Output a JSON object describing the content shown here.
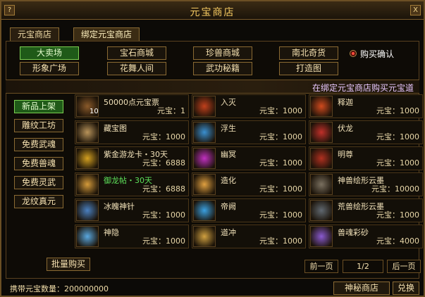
{
  "window": {
    "title": "元宝商店",
    "help_icon": "?",
    "close_icon": "X"
  },
  "tabs": [
    {
      "label": "元宝商店",
      "active": false
    },
    {
      "label": "绑定元宝商店",
      "active": true
    }
  ],
  "categories": [
    {
      "label": "大卖场",
      "active": true
    },
    {
      "label": "宝石商城",
      "active": false
    },
    {
      "label": "珍兽商城",
      "active": false
    },
    {
      "label": "南北奇货",
      "active": false
    },
    {
      "label": "形象广场",
      "active": false
    },
    {
      "label": "花舞人间",
      "active": false
    },
    {
      "label": "武功秘籍",
      "active": false
    },
    {
      "label": "打造图",
      "active": false
    }
  ],
  "purchase_confirm": {
    "label": "购买确认",
    "checked": true
  },
  "banner": "在绑定元宝商店购买元宝道",
  "side_menu": [
    {
      "label": "新品上架",
      "active": true
    },
    {
      "label": "雕纹工坊",
      "active": false
    },
    {
      "label": "免费武魂",
      "active": false
    },
    {
      "label": "免费兽魂",
      "active": false
    },
    {
      "label": "免费灵武",
      "active": false
    },
    {
      "label": "龙纹真元",
      "active": false
    }
  ],
  "items": [
    {
      "name": "50000点元宝票",
      "price": "元宝：1",
      "qty": "10",
      "icon": "ticket-icon",
      "color": "#8a5a2a",
      "green": false
    },
    {
      "name": "入灭",
      "price": "元宝：1000",
      "qty": "",
      "icon": "fire-skill-icon",
      "color": "#c0401c",
      "green": false
    },
    {
      "name": "释迦",
      "price": "元宝：1000",
      "qty": "",
      "icon": "flame-skill-icon",
      "color": "#d04a1e",
      "green": false
    },
    {
      "name": "藏宝图",
      "price": "元宝：1000",
      "qty": "",
      "icon": "treasure-map-icon",
      "color": "#b8935a",
      "green": false
    },
    {
      "name": "浮生",
      "price": "元宝：1000",
      "qty": "",
      "icon": "ice-skill-icon",
      "color": "#3a8fd0",
      "green": false
    },
    {
      "name": "伏龙",
      "price": "元宝：1000",
      "qty": "",
      "icon": "blade-icon",
      "color": "#c0302a",
      "green": false
    },
    {
      "name": "紫金游龙卡・30天",
      "price": "元宝：6888",
      "qty": "",
      "icon": "dragon-card-icon",
      "color": "#d4a020",
      "green": false
    },
    {
      "name": "幽冥",
      "price": "元宝：1000",
      "qty": "",
      "icon": "void-skill-icon",
      "color": "#c030c0",
      "green": false
    },
    {
      "name": "明尊",
      "price": "元宝：1000",
      "qty": "",
      "icon": "staff-icon",
      "color": "#b03020",
      "green": false
    },
    {
      "name": "御龙帖・30天",
      "price": "元宝：6888",
      "qty": "",
      "icon": "scroll-icon",
      "color": "#d49a3a",
      "green": true
    },
    {
      "name": "造化",
      "price": "元宝：1000",
      "qty": "",
      "icon": "storm-skill-icon",
      "color": "#e0a040",
      "green": false
    },
    {
      "name": "神兽绘形云墨",
      "price": "元宝：10000",
      "qty": "",
      "icon": "claw-icon",
      "color": "#7a7060",
      "green": false
    },
    {
      "name": "冰魄神针",
      "price": "元宝：1000",
      "qty": "",
      "icon": "needle-icon",
      "color": "#4a80c0",
      "green": false
    },
    {
      "name": "帝阙",
      "price": "元宝：1000",
      "qty": "",
      "icon": "lightning-skill-icon",
      "color": "#3aa0e0",
      "green": false
    },
    {
      "name": "荒兽绘形云墨",
      "price": "元宝：1000",
      "qty": "",
      "icon": "ink-icon",
      "color": "#606870",
      "green": false
    },
    {
      "name": "神隐",
      "price": "元宝：1000",
      "qty": "",
      "icon": "frost-skill-icon",
      "color": "#5aa8e0",
      "green": false
    },
    {
      "name": "道冲",
      "price": "元宝：1000",
      "qty": "",
      "icon": "spark-skill-icon",
      "color": "#d0a040",
      "green": false
    },
    {
      "name": "兽魂彩砂",
      "price": "元宝：4000",
      "qty": "",
      "icon": "crystal-icon",
      "color": "#8a5ad0",
      "green": false
    }
  ],
  "bulk_buy": "批量购买",
  "pagination": {
    "prev": "前一页",
    "page": "1/2",
    "next": "后一页"
  },
  "footer": {
    "balance_label": "携带元宝数量：200000000",
    "mystery_shop": "神秘商店",
    "exchange": "兑换"
  }
}
